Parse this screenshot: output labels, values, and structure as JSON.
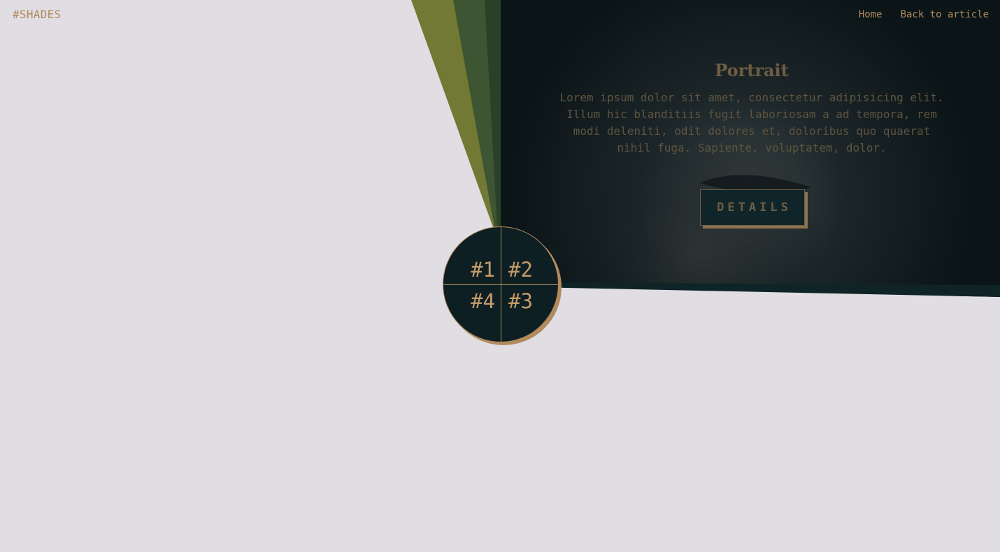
{
  "brand": {
    "logo_text": "#SHADES"
  },
  "nav": {
    "home_label": "Home",
    "back_label": "Back to article"
  },
  "hero": {
    "title": "Portrait",
    "description": "Lorem ipsum dolor sit amet, consectetur adipisicing elit. Illum hic blanditiis fugit laboriosam a ad tempora, rem modi deleniti, odit dolores et, doloribus quo quaerat nihil fuga. Sapiente, voluptatem, dolor.",
    "details_label": "DETAILS"
  },
  "wheel": {
    "items": [
      {
        "label": "#1"
      },
      {
        "label": "#2"
      },
      {
        "label": "#3"
      },
      {
        "label": "#4"
      }
    ]
  },
  "colors": {
    "background": "#e0dee3",
    "accent": "#b28a5e",
    "panel_dark": "#0d1f22",
    "olive": "#717934",
    "green_mid": "#3d5533",
    "green_dark": "#2b4127"
  }
}
